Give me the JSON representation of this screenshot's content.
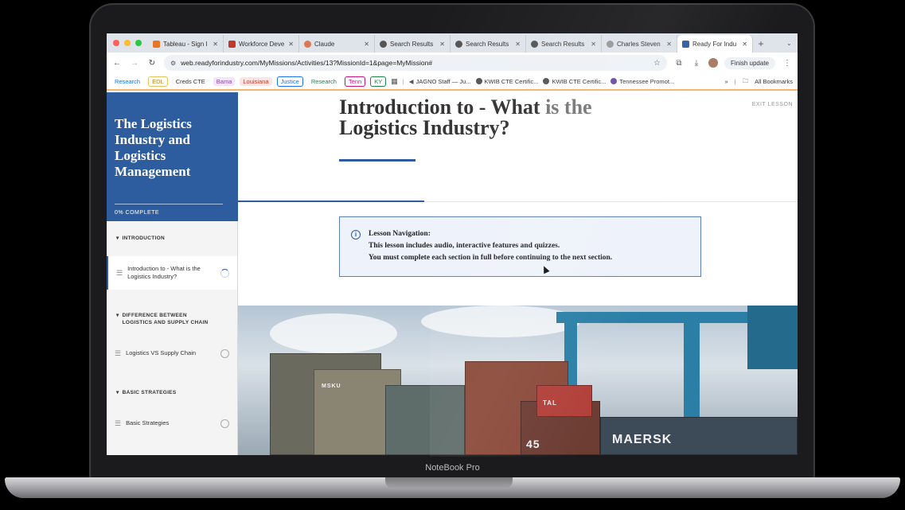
{
  "device": {
    "brand_label": "NoteBook Pro"
  },
  "browser": {
    "tabs": [
      {
        "title": "Tableau - Sign I",
        "icon_color": "#e97627"
      },
      {
        "title": "Workforce Deve",
        "icon_color": "#c0392b"
      },
      {
        "title": "Claude",
        "icon_color": "#d97757"
      },
      {
        "title": "Search Results",
        "icon_color": "#555555"
      },
      {
        "title": "Search Results",
        "icon_color": "#555555"
      },
      {
        "title": "Search Results",
        "icon_color": "#555555"
      },
      {
        "title": "Charles Steven",
        "icon_color": "#777777"
      },
      {
        "title": "Ready For Indu",
        "icon_color": "#2e5d9f"
      }
    ],
    "url": "web.readyforindustry.com/MyMissions/Activities/13?MissionId=1&page=MyMission#",
    "finish_update": "Finish update",
    "bookmarks": [
      {
        "label": "Research",
        "color": "#1a73e8"
      },
      {
        "label": "EDL",
        "color": "#b8860b"
      },
      {
        "label": "Creds CTE",
        "color": "#333333"
      },
      {
        "label": "Bama",
        "color": "#8e44ad"
      },
      {
        "label": "Louisiana",
        "color": "#c0392b"
      },
      {
        "label": "Justice",
        "color": "#1a73e8"
      },
      {
        "label": "Research",
        "color": "#1e8449"
      },
      {
        "label": "Tenn",
        "color": "#c71585"
      },
      {
        "label": "KY",
        "color": "#1e8449"
      }
    ],
    "bookmark_links": [
      "JAGNO Staff — Ju...",
      "KWIB CTE Certific...",
      "KWIB CTE Certific...",
      "Tennessee Promot..."
    ],
    "all_bookmarks": "All Bookmarks"
  },
  "course": {
    "title": "The Logistics Industry and Logistics Management",
    "progress_text": "0% COMPLETE",
    "progress_fraction": 0,
    "sections": [
      {
        "title": "INTRODUCTION",
        "lessons": [
          {
            "label": "Introduction to - What is the Logistics Industry?",
            "status": "in-progress"
          }
        ]
      },
      {
        "title": "DIFFERENCE BETWEEN LOGISTICS AND SUPPLY CHAIN",
        "lessons": [
          {
            "label": "Logistics VS Supply Chain",
            "status": "not-started"
          }
        ]
      },
      {
        "title": "BASIC STRATEGIES",
        "lessons": [
          {
            "label": "Basic Strategies",
            "status": "not-started"
          }
        ]
      }
    ]
  },
  "lesson": {
    "title_main": "Introduction to - What ",
    "title_fade": "is the",
    "title_rest": "Logistics Industry?",
    "exit_label": "EXIT LESSON",
    "notice_heading": "Lesson Navigation:",
    "notice_line1": "This lesson includes audio, interactive features and quizzes.",
    "notice_line2": "You must complete each section in full before continuing to the next section.",
    "hero_texts": [
      "MSKU",
      "TAL",
      "45",
      "MAERSK"
    ]
  },
  "colors": {
    "brand_blue": "#2e5d9f",
    "accent_orange": "#f5b56b"
  }
}
